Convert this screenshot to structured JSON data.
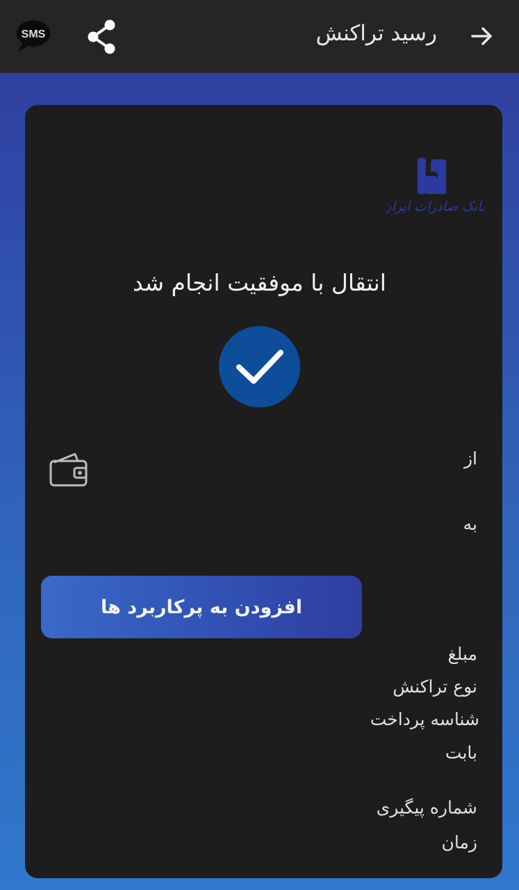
{
  "header": {
    "title": "رسید تراکنش",
    "back_icon": "arrow-right-icon",
    "share_icon": "share-icon",
    "sms_icon": "sms-icon",
    "sms_label": "SMS"
  },
  "receipt": {
    "bank_logo_text": "بانک صادرات ایران",
    "success_message": "انتقال با موفقیت انجام شد",
    "from_label": "از",
    "to_label": "به",
    "add_button_label": "افزودن به پرکاربرد ها",
    "amount_label": "مبلغ",
    "transaction_type_label": "نوع تراکنش",
    "payment_id_label": "شناسه پرداخت",
    "reason_label": "بابت",
    "tracking_number_label": "شماره پیگیری",
    "time_label": "زمان"
  },
  "colors": {
    "topbar": "#252525",
    "card": "#1d1d1e",
    "success_circle": "#0d4d9a",
    "bank_logo": "#2b3a9e",
    "button_gradient_start": "#3a6ac8",
    "button_gradient_end": "#2e3ea0"
  }
}
